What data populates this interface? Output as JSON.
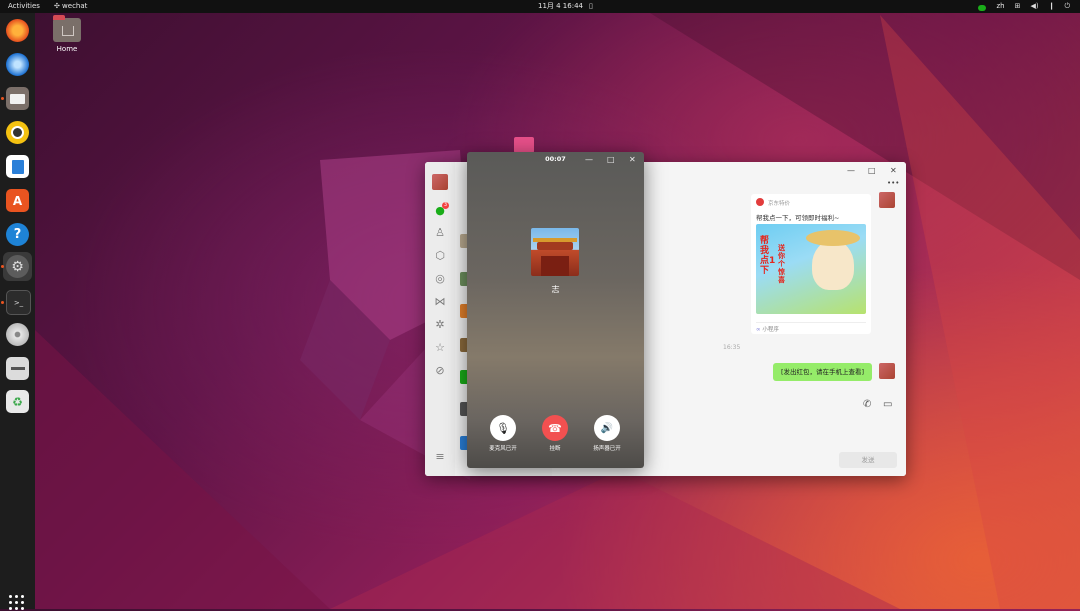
{
  "topbar": {
    "activities": "Activities",
    "app_name": "wechat",
    "datetime": "11月 4  16:44",
    "lang": "zh"
  },
  "desktop": {
    "home_label": "Home"
  },
  "wechat": {
    "badge_count": "3",
    "card_source": "京东特价",
    "card_text": "帮我点一下，可领即时福利~",
    "banner_text_left": "帮我点1下",
    "banner_text_right": "送你个惊喜",
    "mini_program": "小程序",
    "time_divider": "16:35",
    "sent_message": "[发出红包，请在手机上查看]",
    "send_button": "发送"
  },
  "call": {
    "timer": "00:07",
    "name": "志",
    "mic_label": "麦克风已开",
    "hangup_label": "挂断",
    "speaker_label": "扬声器已开"
  },
  "colors": {
    "accent": "#e95420",
    "wechat_green": "#95ec69",
    "hangup_red": "#f25050"
  }
}
